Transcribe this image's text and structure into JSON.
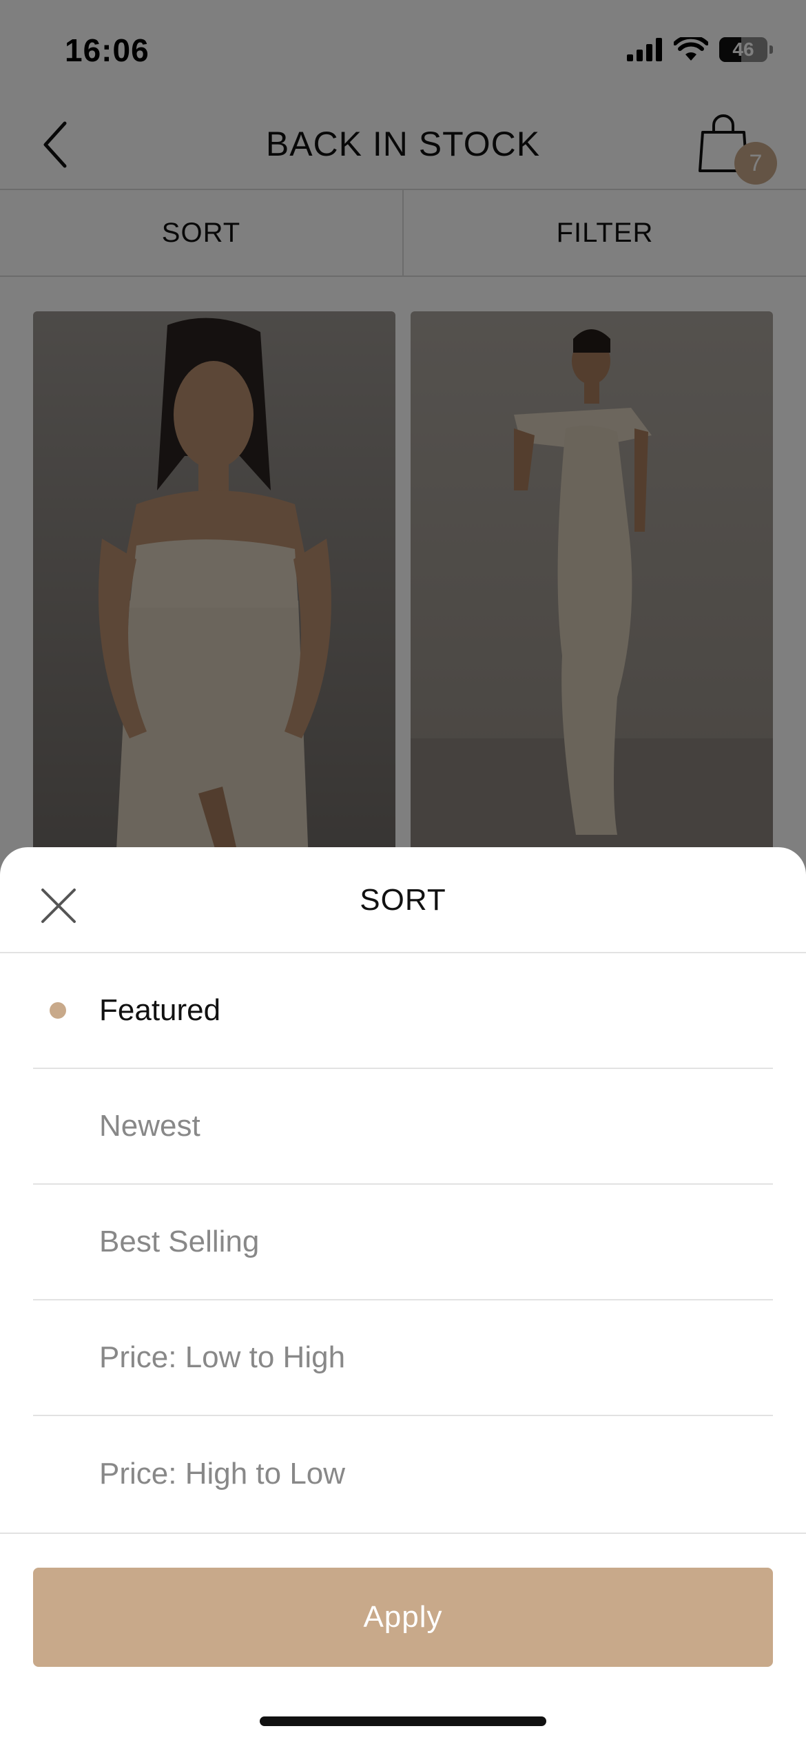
{
  "status_bar": {
    "time": "16:06",
    "battery": "46"
  },
  "header": {
    "title": "BACK IN STOCK",
    "cart_count": "7"
  },
  "toolbar": {
    "sort_label": "SORT",
    "filter_label": "FILTER"
  },
  "sort_sheet": {
    "title": "SORT",
    "options": [
      {
        "label": "Featured",
        "selected": true
      },
      {
        "label": "Newest",
        "selected": false
      },
      {
        "label": "Best Selling",
        "selected": false
      },
      {
        "label": "Price: Low to High",
        "selected": false
      },
      {
        "label": "Price: High to Low",
        "selected": false
      }
    ],
    "apply_label": "Apply"
  },
  "colors": {
    "accent": "#c8a98a",
    "overlay": "rgba(0,0,0,0.5)"
  },
  "icons": [
    "chevron-left-icon",
    "shopping-bag-icon",
    "close-icon",
    "signal-icon",
    "wifi-icon",
    "battery-icon"
  ]
}
